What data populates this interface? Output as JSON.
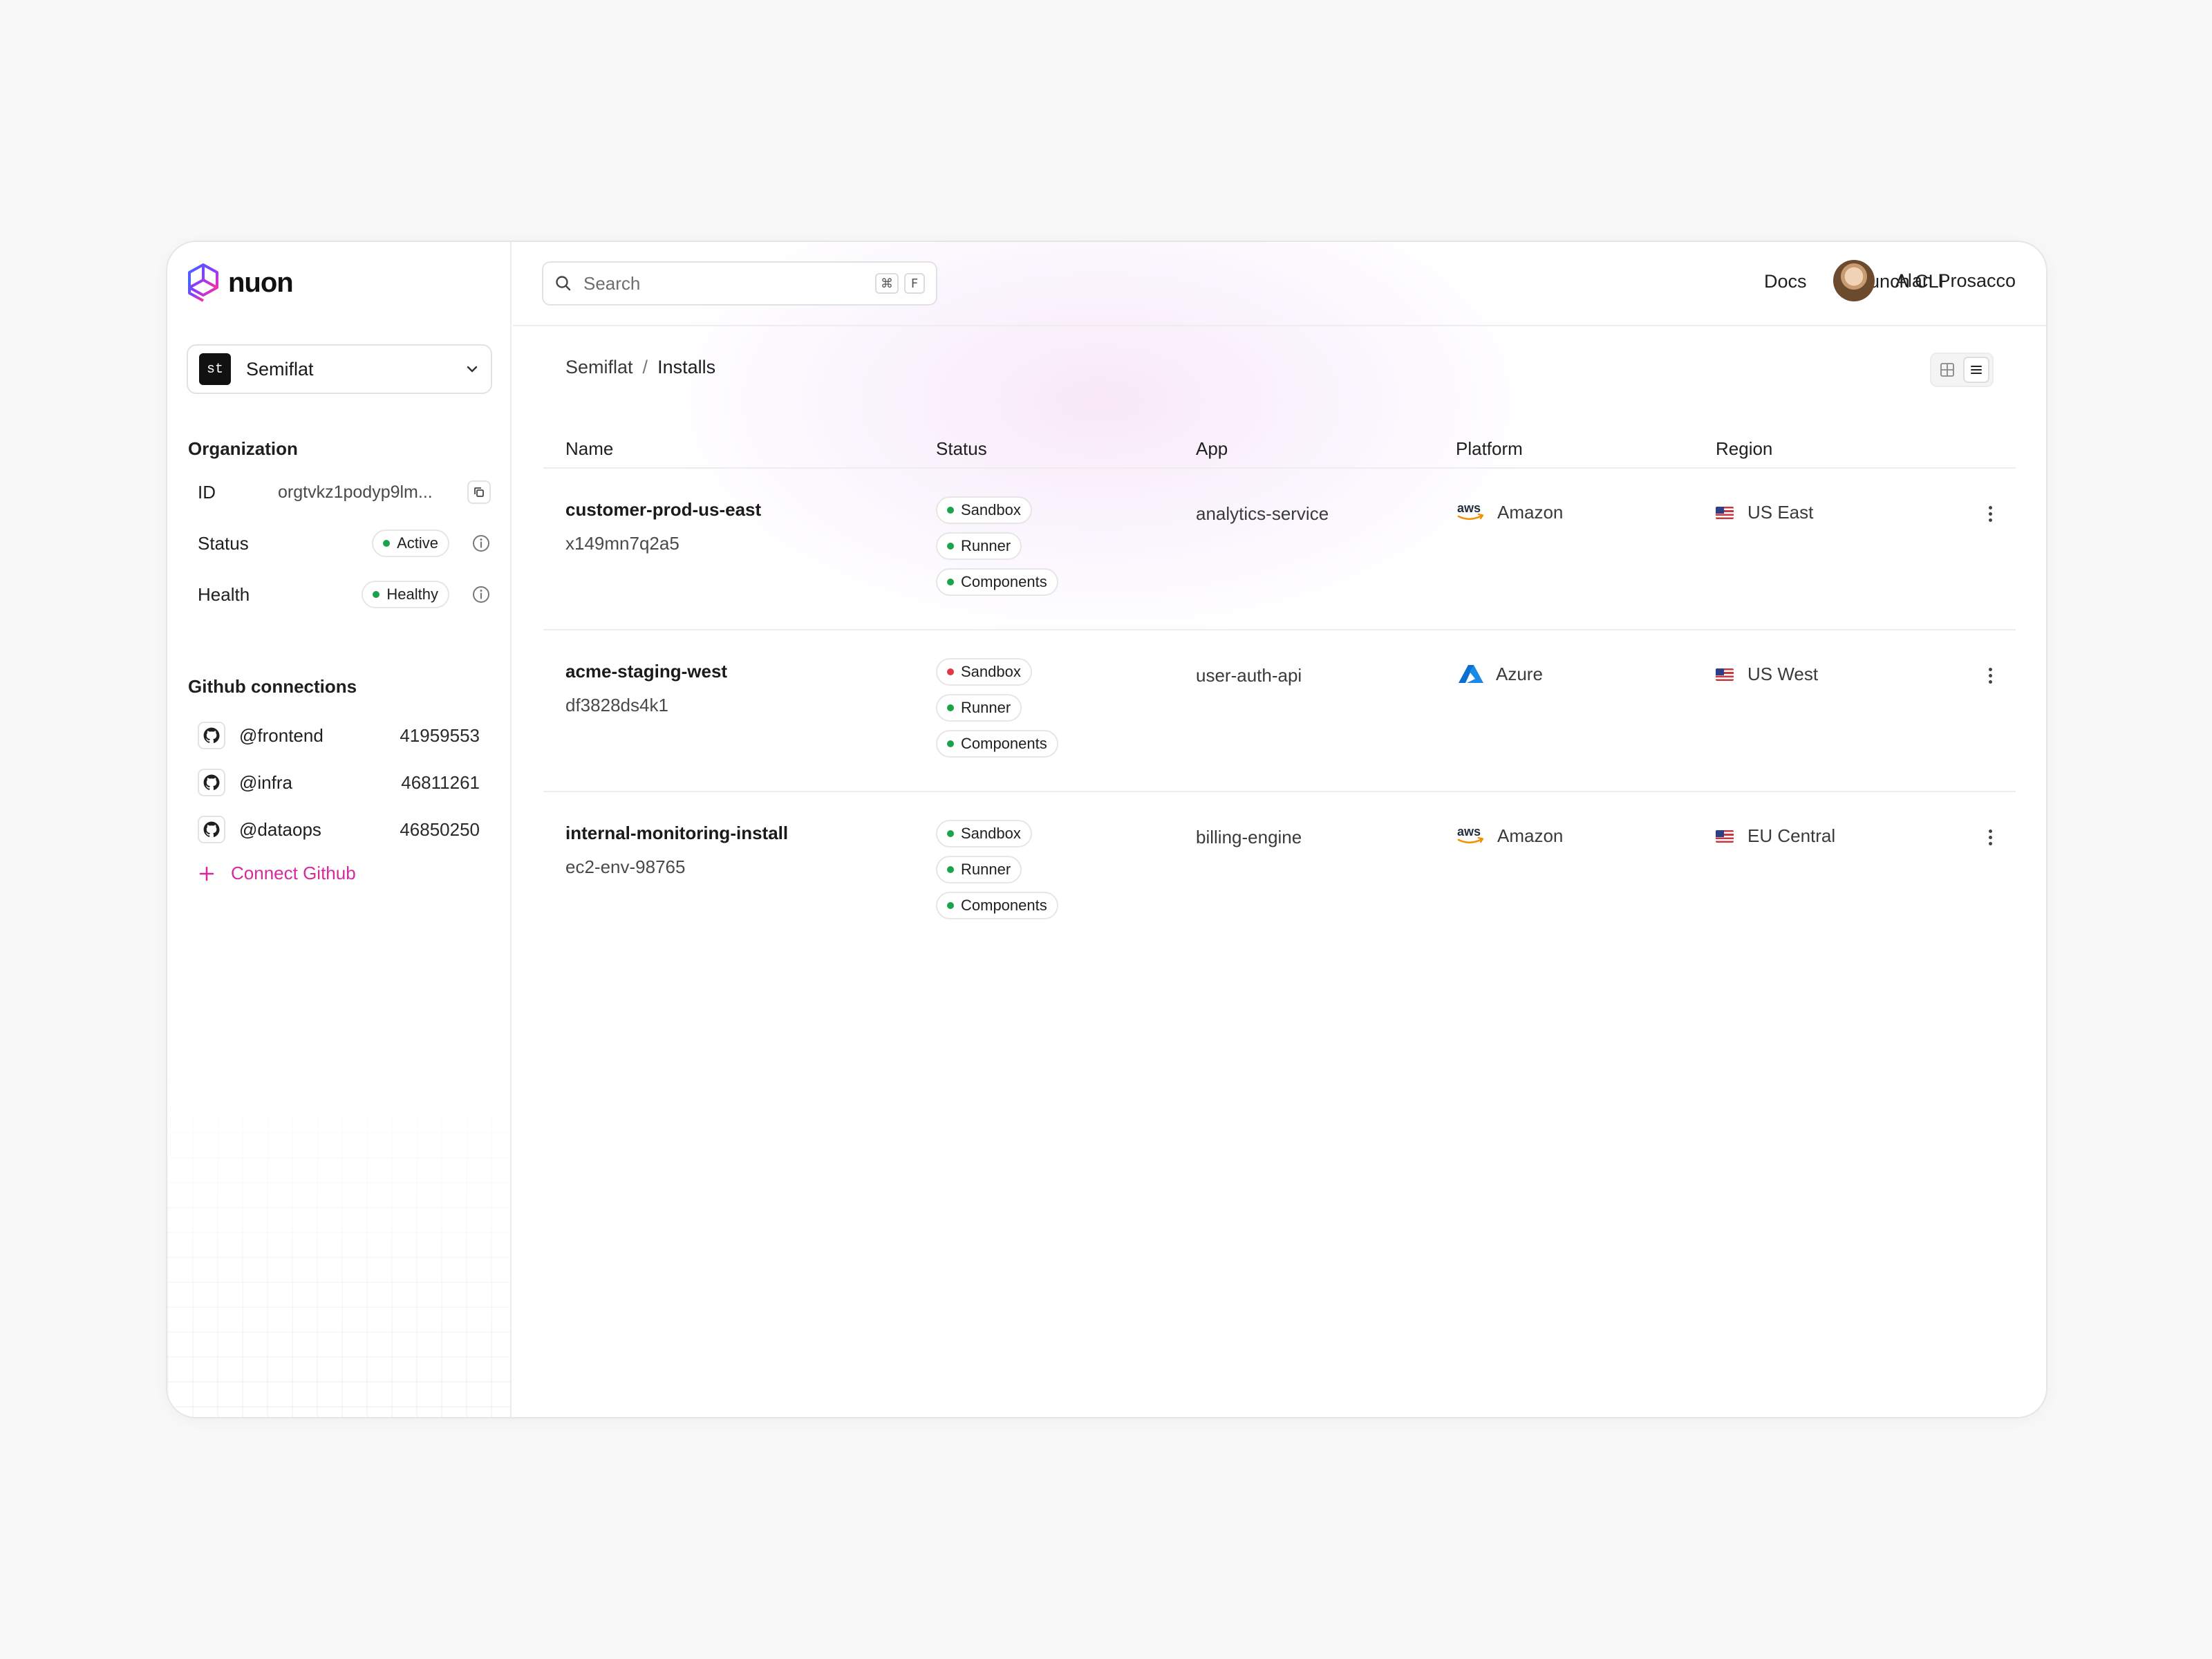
{
  "brand": {
    "name": "nuon"
  },
  "org_switcher": {
    "initials": "st",
    "name": "Semiflat"
  },
  "organization": {
    "title": "Organization",
    "id_label": "ID",
    "id_value": "orgtvkz1podyp9lm...",
    "status_label": "Status",
    "status_value": "Active",
    "health_label": "Health",
    "health_value": "Healthy"
  },
  "github": {
    "title": "Github connections",
    "connections": [
      {
        "handle": "@frontend",
        "id": "41959553"
      },
      {
        "handle": "@infra",
        "id": "46811261"
      },
      {
        "handle": "@dataops",
        "id": "46850250"
      }
    ],
    "connect_label": "Connect Github"
  },
  "topbar": {
    "search_placeholder": "Search",
    "shortcut_keys": [
      "⌘",
      "F"
    ],
    "docs_label": "Docs",
    "cli_label": "Launch CLI",
    "user_name": "Alan Prosacco"
  },
  "breadcrumb": {
    "parent": "Semiflat",
    "separator": "/",
    "current": "Installs"
  },
  "table": {
    "columns": [
      "Name",
      "Status",
      "App",
      "Platform",
      "Region"
    ],
    "rows": [
      {
        "name": "customer-prod-us-east",
        "id": "x149mn7q2a5",
        "statuses": [
          {
            "label": "Sandbox",
            "state": "green"
          },
          {
            "label": "Runner",
            "state": "green"
          },
          {
            "label": "Components",
            "state": "green"
          }
        ],
        "app": "analytics-service",
        "platform": "Amazon",
        "platform_icon": "aws-icon",
        "region": "US East"
      },
      {
        "name": "acme-staging-west",
        "id": "df3828ds4k1",
        "statuses": [
          {
            "label": "Sandbox",
            "state": "red"
          },
          {
            "label": "Runner",
            "state": "green"
          },
          {
            "label": "Components",
            "state": "green"
          }
        ],
        "app": "user-auth-api",
        "platform": "Azure",
        "platform_icon": "azure-icon",
        "region": "US West"
      },
      {
        "name": "internal-monitoring-install",
        "id": "ec2-env-98765",
        "statuses": [
          {
            "label": "Sandbox",
            "state": "green"
          },
          {
            "label": "Runner",
            "state": "green"
          },
          {
            "label": "Components",
            "state": "green"
          }
        ],
        "app": "billing-engine",
        "platform": "Amazon",
        "platform_icon": "aws-icon",
        "region": "EU Central"
      }
    ]
  },
  "colors": {
    "accent": "#d42aa0",
    "status_ok": "#1aa34a",
    "status_error": "#e0383e",
    "azure_blue": "#0a6fd1",
    "aws_orange": "#f29100"
  }
}
